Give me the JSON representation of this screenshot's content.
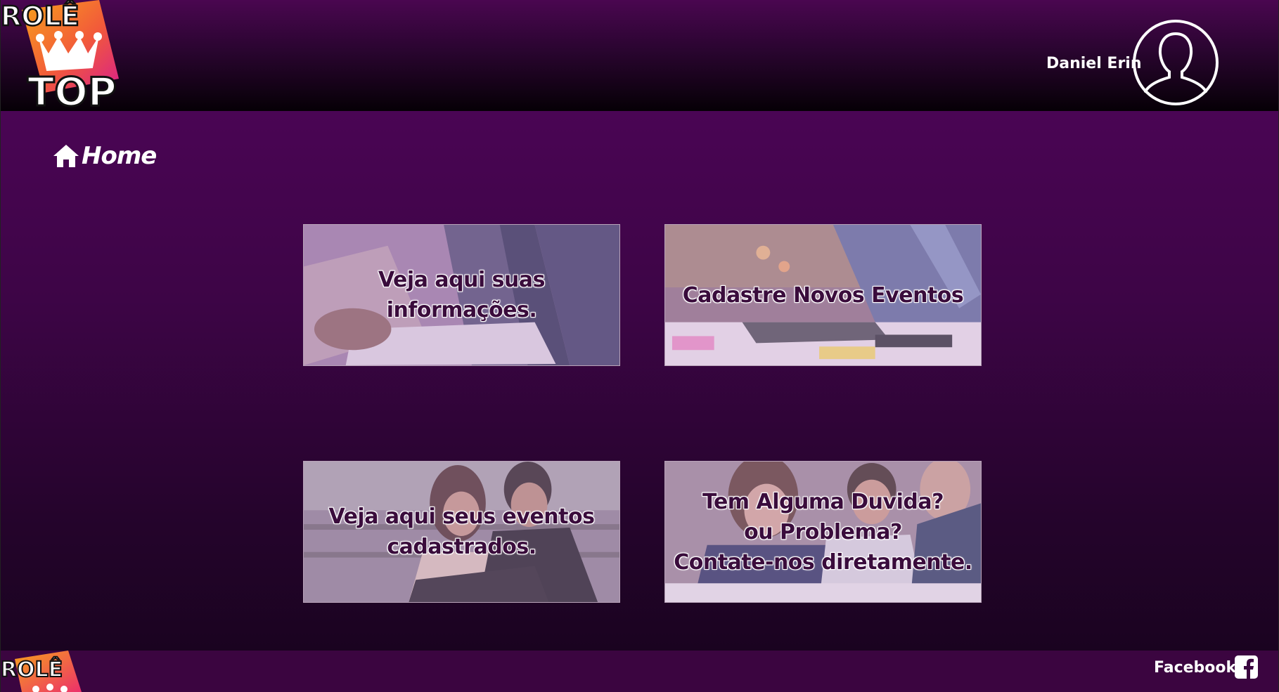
{
  "header": {
    "logo_top": "ROLÊ",
    "logo_bottom": "TOP",
    "user_name": "Daniel Erin"
  },
  "nav": {
    "home_label": "Home"
  },
  "cards": [
    {
      "text": "Veja aqui suas\ninformações."
    },
    {
      "text": "Cadastre Novos Eventos"
    },
    {
      "text": "Veja aqui seus eventos\ncadastrados."
    },
    {
      "text": "Tem Alguma Duvida?\nou Problema?\nContate-nos diretamente."
    }
  ],
  "footer": {
    "logo_top": "ROLÊ",
    "facebook_label": "Facebook:"
  },
  "colors": {
    "header_top": "#4a0650",
    "main_bg": "#3d0546",
    "logo_orange": "#f7a21b",
    "logo_pink": "#ec2f6b"
  },
  "icons": [
    "crown-icon",
    "avatar-icon",
    "home-icon",
    "facebook-icon",
    "instagram-icon"
  ]
}
